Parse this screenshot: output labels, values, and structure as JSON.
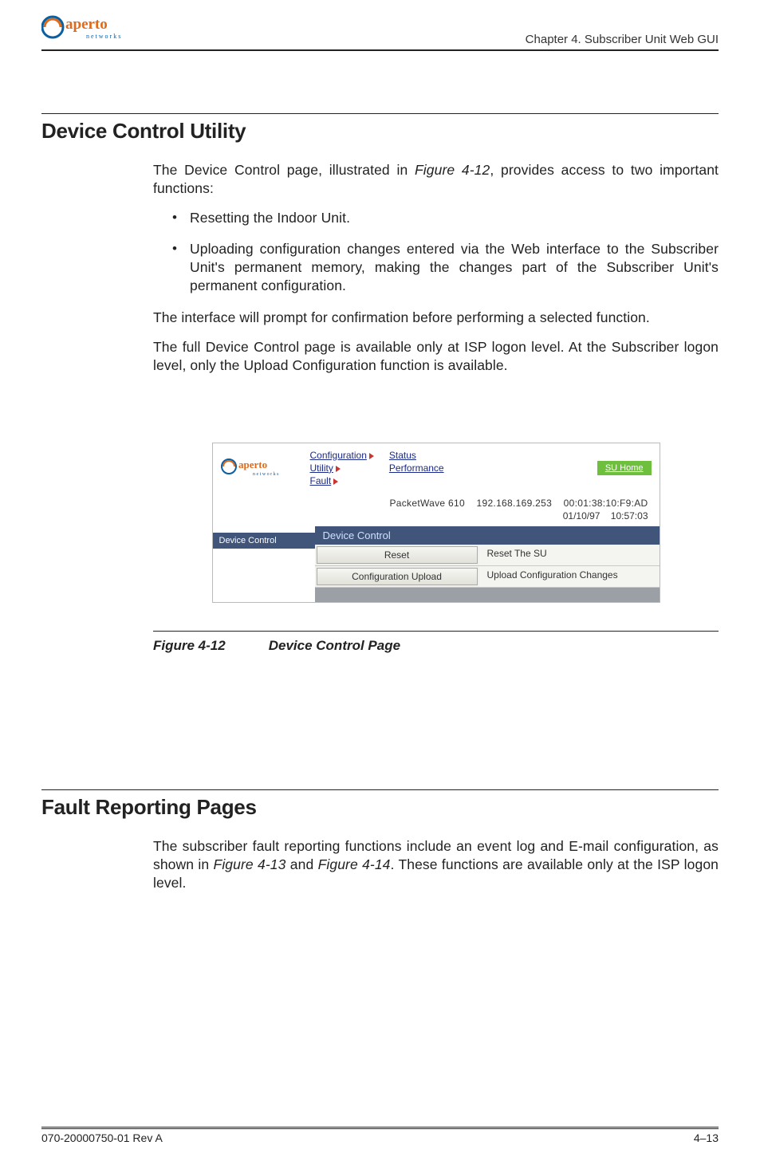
{
  "header": {
    "logo_top": "aperto",
    "logo_sub": "networks",
    "chapter": "Chapter 4.  Subscriber Unit Web GUI"
  },
  "section1": {
    "title": "Device Control Utility",
    "intro_a": "The Device Control page, illustrated in ",
    "fig_ref1": "Figure 4-12",
    "intro_b": ", provides access to two important functions:",
    "bullet1": "Resetting the Indoor Unit.",
    "bullet2": "Uploading configuration changes entered via the Web interface to the Subscriber Unit's permanent memory, making the changes part of the Subscriber Unit's permanent configuration.",
    "para2": "The interface will prompt for confirmation before performing a selected function.",
    "para3": "The full Device Control page is available only at ISP logon level. At the Subscriber logon level, only the Upload Configuration function is available."
  },
  "screenshot": {
    "logo_top": "aperto",
    "logo_sub": "networks",
    "links_col1": [
      "Configuration",
      "Utility",
      "Fault"
    ],
    "links_col2": [
      "Status",
      "Performance"
    ],
    "su_home": "SU Home",
    "device": "PacketWave 610",
    "ip": "192.168.169.253",
    "mac": "00:01:38:10:F9:AD",
    "date": "01/10/97",
    "time": "10:57:03",
    "sidebar_item": "Device Control",
    "panel_title": "Device Control",
    "rows": [
      {
        "btn": "Reset",
        "label": "Reset The SU"
      },
      {
        "btn": "Configuration Upload",
        "label": "Upload Configuration Changes"
      }
    ]
  },
  "figure1": {
    "num": "Figure 4-12",
    "title": "Device Control Page"
  },
  "section2": {
    "title": "Fault Reporting Pages",
    "para_a": "The subscriber fault reporting functions include an event log and E-mail configuration, as shown in ",
    "ref1": "Figure 4-13",
    "and": " and ",
    "ref2": "Figure 4-14",
    "para_b": ". These functions are available only at the ISP logon level."
  },
  "footer": {
    "doc": "070-20000750-01 Rev A",
    "page": "4–13"
  }
}
